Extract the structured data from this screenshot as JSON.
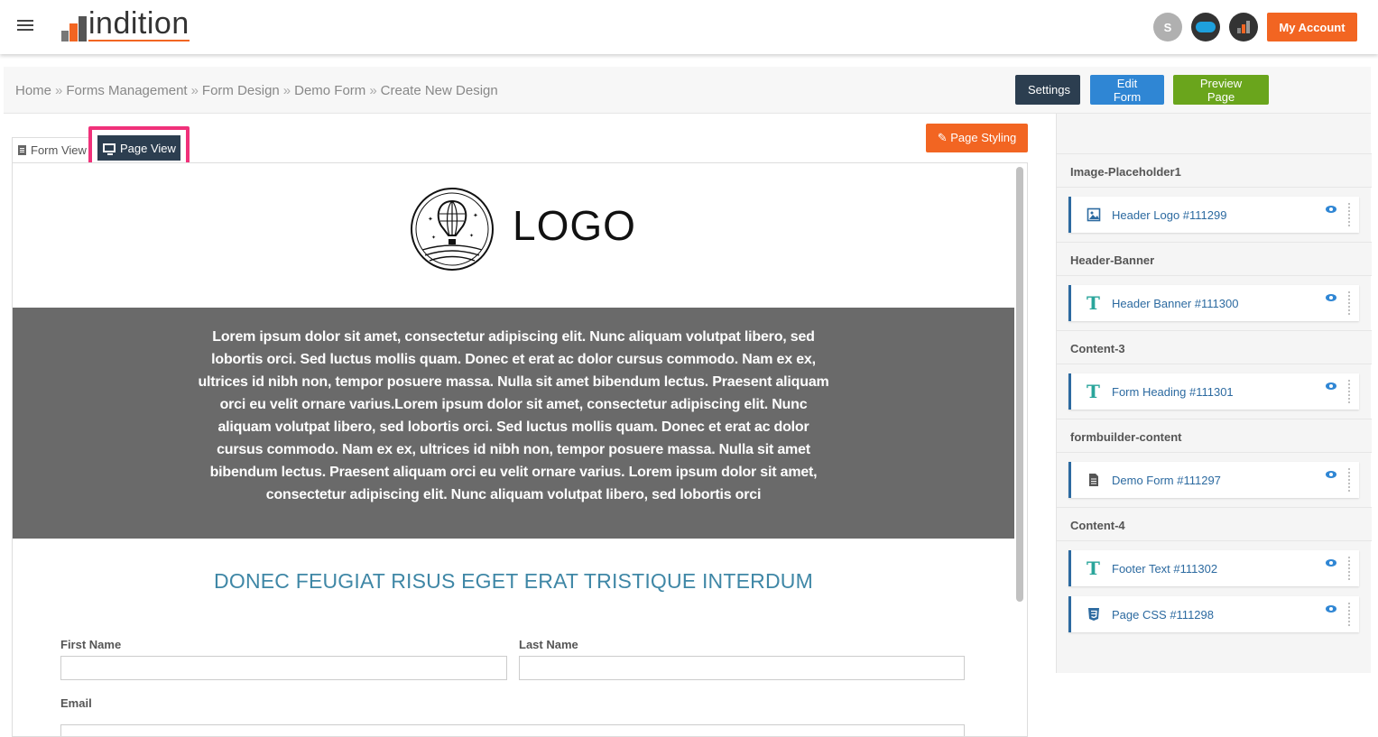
{
  "header": {
    "brand": "indition",
    "integrations": [
      "shopify-icon",
      "salesforce-icon",
      "indition-icon"
    ],
    "my_account_label": "My Account"
  },
  "breadcrumb": {
    "items": [
      "Home",
      "Forms Management",
      "Form Design",
      "Demo Form"
    ],
    "separator": "»",
    "current": "Create New Design"
  },
  "toolbar": {
    "settings_label": "Settings",
    "edit_form_label": "Edit Form",
    "preview_page_label": "Preview Page"
  },
  "tabs": {
    "form_view_label": "Form View",
    "page_view_label": "Page View",
    "active": "Page View"
  },
  "page_styling_label": "Page Styling",
  "preview": {
    "logo_text": "LOGO",
    "banner_text": "Lorem ipsum dolor sit amet, consectetur adipiscing elit. Nunc aliquam volutpat libero, sed lobortis orci. Sed luctus mollis quam. Donec et erat ac dolor cursus commodo. Nam ex ex, ultrices id nibh non, tempor posuere massa. Nulla sit amet bibendum lectus. Praesent aliquam orci eu velit ornare varius.Lorem ipsum dolor sit amet, consectetur adipiscing elit. Nunc aliquam volutpat libero, sed lobortis orci. Sed luctus mollis quam. Donec et erat ac dolor cursus commodo. Nam ex ex, ultrices id nibh non, tempor posuere massa. Nulla sit amet bibendum lectus. Praesent aliquam orci eu velit ornare varius. Lorem ipsum dolor sit amet, consectetur adipiscing elit. Nunc aliquam volutpat libero, sed lobortis orci",
    "form_heading": "DONEC FEUGIAT RISUS EGET ERAT TRISTIQUE INTERDUM",
    "fields": {
      "first_name_label": "First Name",
      "last_name_label": "Last Name",
      "email_label": "Email"
    }
  },
  "sidebar": {
    "groups": [
      {
        "name": "Image-Placeholder1",
        "items": [
          {
            "label": "Header Logo #111299",
            "icon": "image-icon"
          }
        ]
      },
      {
        "name": "Header-Banner",
        "items": [
          {
            "label": "Header Banner #111300",
            "icon": "text-icon"
          }
        ]
      },
      {
        "name": "Content-3",
        "items": [
          {
            "label": "Form Heading #111301",
            "icon": "text-icon"
          }
        ]
      },
      {
        "name": "formbuilder-content",
        "items": [
          {
            "label": "Demo Form #111297",
            "icon": "document-icon"
          }
        ]
      },
      {
        "name": "Content-4",
        "items": [
          {
            "label": "Footer Text #111302",
            "icon": "text-icon"
          },
          {
            "label": "Page CSS #111298",
            "icon": "css3-icon"
          }
        ]
      }
    ]
  },
  "colors": {
    "accent_orange": "#f26522",
    "dark_navy": "#2c3e50",
    "blue": "#2f86d4",
    "green": "#6aa51c",
    "highlight_pink": "#f0317a",
    "heading_teal": "#3f87a6",
    "banner_gray": "#6a6a6a"
  }
}
